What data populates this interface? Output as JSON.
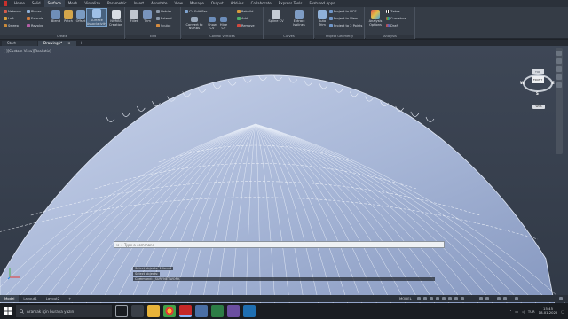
{
  "ribbon_tabs": [
    "Home",
    "Solid",
    "Surface",
    "Mesh",
    "Visualize",
    "Parametric",
    "Insert",
    "Annotate",
    "View",
    "Manage",
    "Output",
    "Add-ins",
    "Collaborate",
    "Express Tools",
    "Featured Apps"
  ],
  "active_tab_index": 2,
  "panels": {
    "create": {
      "title": "Create",
      "small_items": [
        "Network",
        "Loft",
        "Sweep",
        "Planar",
        "Extrude",
        "Revolve"
      ],
      "big_items": [
        "Blend",
        "Patch",
        "Offset",
        "Surface Associativity",
        "NURBS Creation"
      ]
    },
    "edit": {
      "title": "Edit",
      "big_items": [
        "Fillet",
        "Trim"
      ],
      "small_items": [
        "Untrim",
        "Extend",
        "Sculpt"
      ]
    },
    "control_vertices": {
      "title": "Control Vertices",
      "items": [
        "CV Edit Bar",
        "Convert to NURBS",
        "Show CV",
        "Hide CV",
        "Rebuild",
        "Add",
        "Remove"
      ]
    },
    "curves": {
      "title": "Curves",
      "items": [
        "Spline CV",
        "Extract Isolines"
      ]
    },
    "project_geometry": {
      "title": "Project Geometry",
      "items": [
        "Auto Trim",
        "Project to UCS",
        "Project to View",
        "Project to 2 Points"
      ]
    },
    "analysis": {
      "title": "Analysis",
      "items": [
        "Analysis Options",
        "Zebra",
        "Curvature",
        "Draft"
      ]
    }
  },
  "file_tabs": [
    "Start",
    "Drawing1*"
  ],
  "active_file_tab": 1,
  "file_tab_close": "×",
  "file_tab_add": "+",
  "viewport_label": "[-][Custom View][Realistic]",
  "viewcube": {
    "top": "TOP",
    "front": "FRONT",
    "n": "N",
    "s": "S",
    "e": "E",
    "w": "W",
    "wcs": "WCS"
  },
  "command_history": [
    "Select objects: 1 found",
    "Select objects:",
    "Command: _SURFNETWORK",
    "Command:"
  ],
  "command_input_placeholder": "Type a command",
  "command_close_symbol": "×",
  "layout_tabs": [
    "Model",
    "Layout1",
    "Layout2"
  ],
  "layout_add": "+",
  "status_model": "MODEL",
  "taskbar": {
    "search_placeholder": "Aramak için buraya yazın",
    "clock_time": "15:45",
    "clock_date": "18.01.2022",
    "language": "TUR"
  },
  "colors": {
    "surface_fill": "#a9b8d8",
    "surface_line": "#e8eef8",
    "accent": "#48627f"
  }
}
